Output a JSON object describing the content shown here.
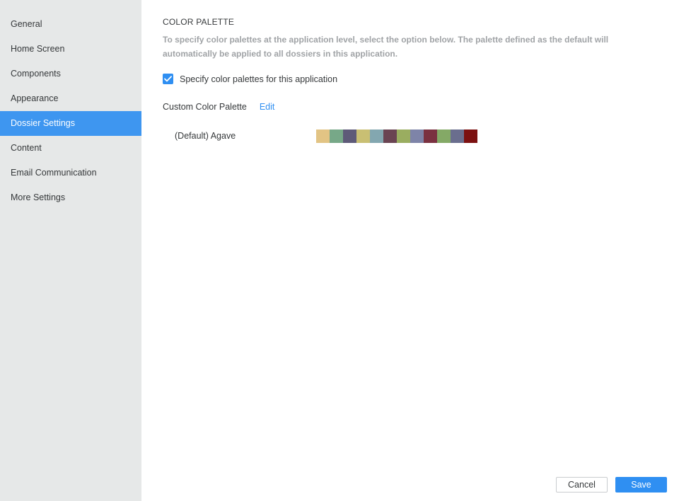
{
  "sidebar": {
    "items": [
      {
        "label": "General"
      },
      {
        "label": "Home Screen"
      },
      {
        "label": "Components"
      },
      {
        "label": "Appearance"
      },
      {
        "label": "Dossier Settings"
      },
      {
        "label": "Content"
      },
      {
        "label": "Email Communication"
      },
      {
        "label": "More Settings"
      }
    ],
    "active_item": "Dossier Settings"
  },
  "section": {
    "title": "COLOR PALETTE",
    "description": "To specify color palettes at the application level, select the option below. The palette defined as the default will automatically be applied to all dossiers in this application."
  },
  "checkbox": {
    "label": "Specify color palettes for this application",
    "checked": true,
    "icon": "checkmark-icon"
  },
  "custom_palette": {
    "label": "Custom Color Palette",
    "edit_label": "Edit",
    "palettes": [
      {
        "name": "(Default) Agave",
        "colors": [
          "#e2c484",
          "#77a888",
          "#5e5a78",
          "#c9bf73",
          "#83a7b0",
          "#6a4452",
          "#9aad60",
          "#7e84a8",
          "#7a3140",
          "#84a966",
          "#6a6e8e",
          "#7c1111"
        ]
      }
    ]
  },
  "footer": {
    "cancel_label": "Cancel",
    "save_label": "Save"
  },
  "colors": {
    "accent": "#2f8ff2",
    "sidebar_active": "#3e96f0",
    "sidebar_bg": "#e6e8e8"
  }
}
